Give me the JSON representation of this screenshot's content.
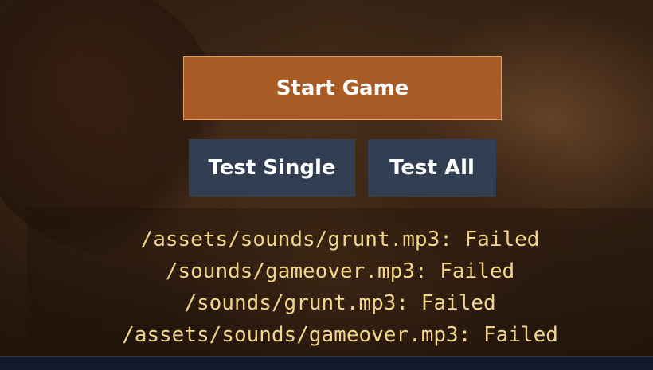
{
  "buttons": {
    "start_label": "Start Game",
    "test_single_label": "Test Single",
    "test_all_label": "Test All"
  },
  "log": {
    "lines": [
      "/assets/sounds/grunt.mp3: Failed",
      "/sounds/gameover.mp3: Failed",
      "/sounds/grunt.mp3: Failed",
      "/assets/sounds/gameover.mp3: Failed"
    ]
  },
  "colors": {
    "start_button": "#a85b25",
    "test_button": "#323e52",
    "log_text": "#f2d58a"
  }
}
